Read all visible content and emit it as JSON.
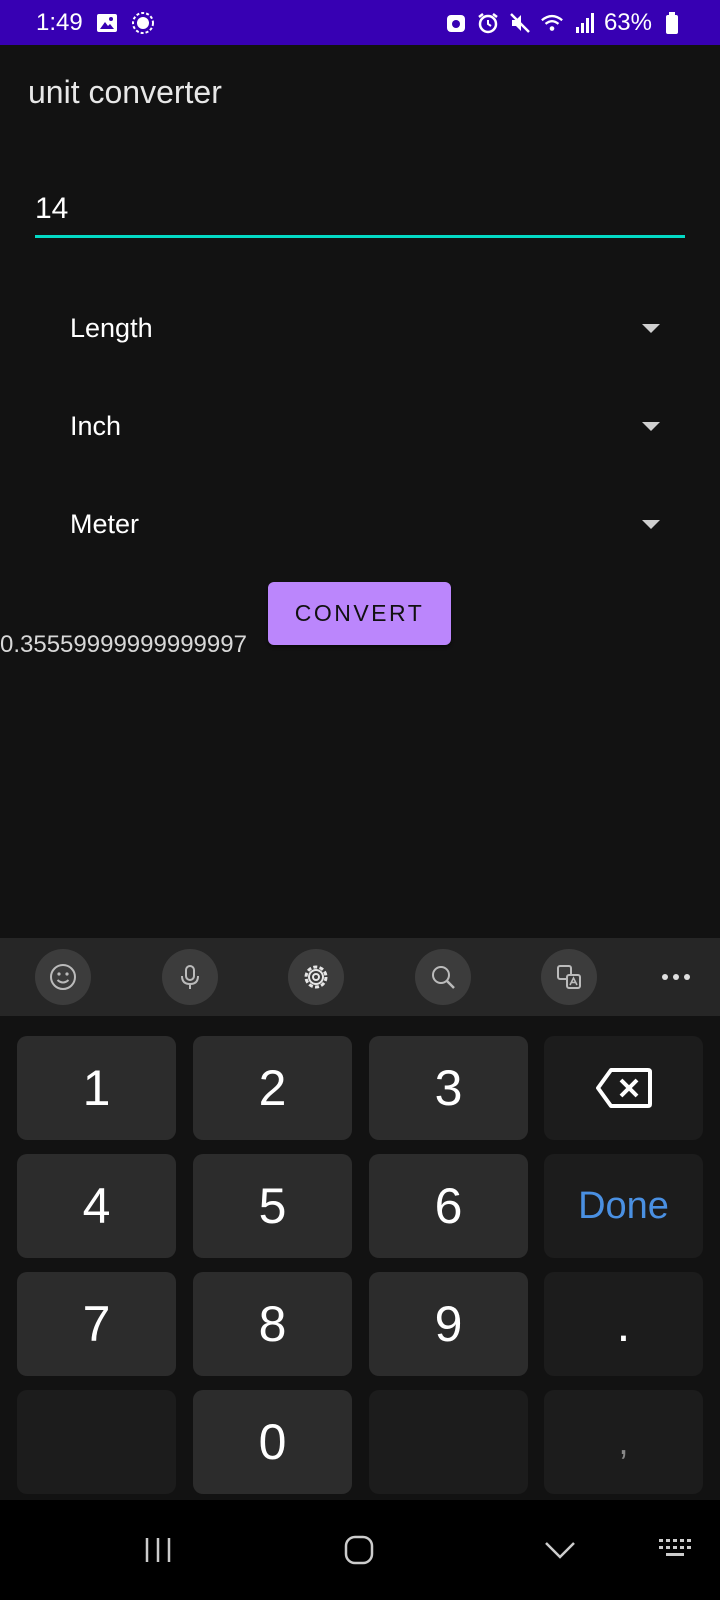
{
  "status_bar": {
    "time": "1:49",
    "battery": "63%",
    "left_icons": [
      "image-icon",
      "signal-app-icon"
    ],
    "right_icons": [
      "accessibility-icon",
      "alarm-icon",
      "mute-icon",
      "wifi-icon",
      "cell-signal-icon",
      "battery-icon"
    ]
  },
  "app": {
    "title": "unit converter",
    "input": {
      "value": "14"
    },
    "spinners": [
      {
        "label": "Length"
      },
      {
        "label": "Inch"
      },
      {
        "label": "Meter"
      }
    ],
    "convert_label": "CONVERT",
    "result": "0.35559999999999997"
  },
  "keyboard": {
    "toolbar_icons": [
      "emoji-icon",
      "microphone-icon",
      "settings-icon",
      "search-icon",
      "translate-icon",
      "more-icon"
    ],
    "keys": {
      "k1": "1",
      "k2": "2",
      "k3": "3",
      "k4": "4",
      "k5": "5",
      "k6": "6",
      "k7": "7",
      "k8": "8",
      "k9": "9",
      "k0": "0",
      "done": "Done",
      "period": ".",
      "comma": ","
    }
  },
  "nav_bar": {
    "icons": [
      "recents-icon",
      "home-icon",
      "back-icon",
      "keyboard-switch-icon"
    ]
  },
  "colors": {
    "status_bar": "#3700B3",
    "background": "#121212",
    "accent": "#03DAC5",
    "button": "#BB86FC",
    "done_text": "#4A90E2"
  }
}
